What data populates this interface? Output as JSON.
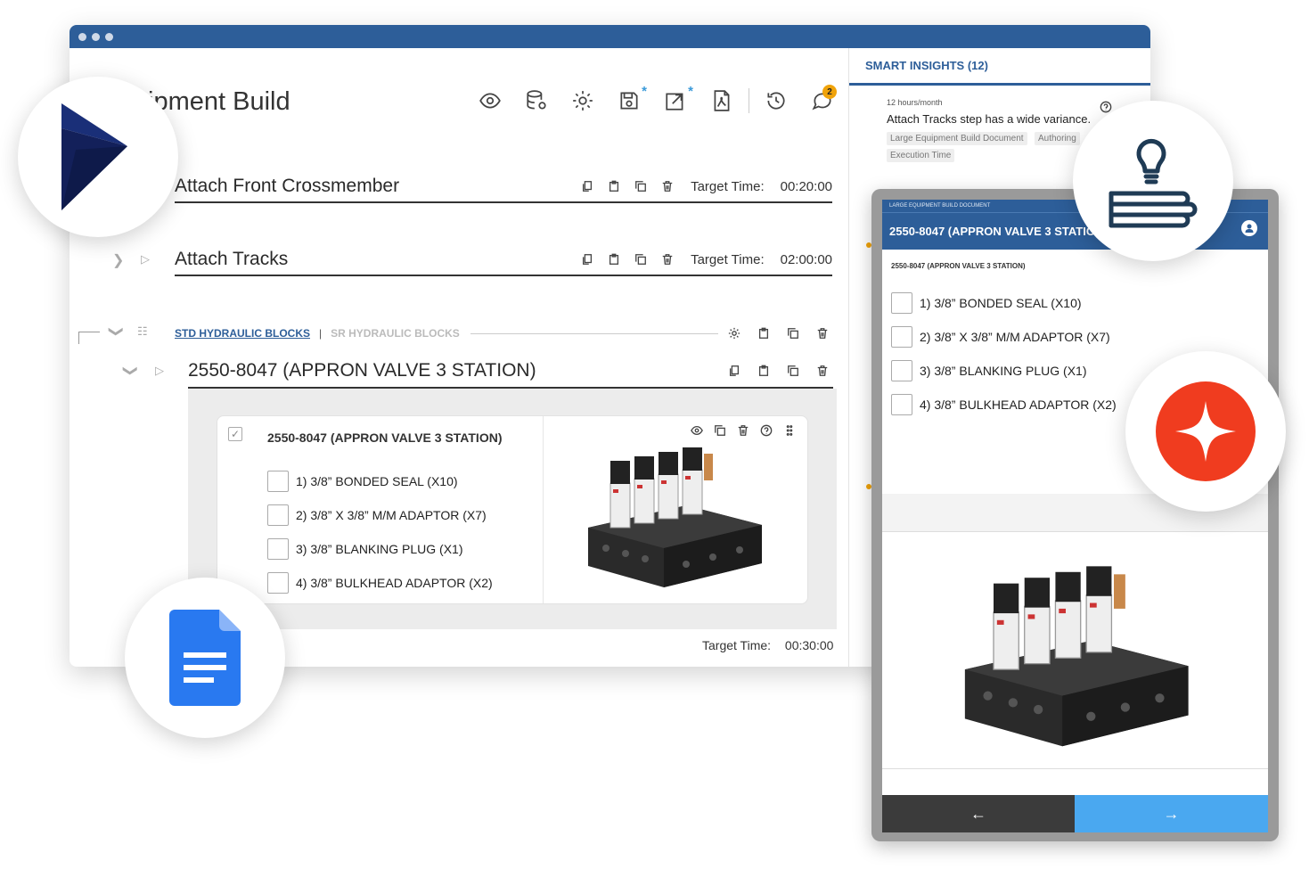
{
  "window": {
    "doc_title": "ipment Build"
  },
  "steps": [
    {
      "name": "Attach Front Crossmember",
      "target_label": "Target Time:",
      "target_value": "00:20:00"
    },
    {
      "name": "Attach Tracks",
      "target_label": "Target Time:",
      "target_value": "02:00:00"
    }
  ],
  "groups": {
    "active": "STD HYDRAULIC BLOCKS",
    "separator": "|",
    "other": "SR HYDRAULIC BLOCKS"
  },
  "substep": {
    "name": "2550-8047 (APPRON VALVE 3 STATION)"
  },
  "card": {
    "title": "2550-8047 (APPRON VALVE 3 STATION)",
    "items": [
      "1) 3/8” BONDED SEAL (X10)",
      "2) 3/8” X 3/8” M/M ADAPTOR (X7)",
      "3) 3/8” BLANKING PLUG (X1)",
      "4) 3/8” BULKHEAD ADAPTOR (X2)"
    ]
  },
  "bottom_target": {
    "label": "Target Time:",
    "value": "00:30:00"
  },
  "toolbar": {
    "comment_badge": "2"
  },
  "insights": {
    "heading": "SMART INSIGHTS (12)",
    "item_meta": "12 hours/month",
    "item_bold": "Attach Tracks",
    "item_text": " step has a wide variance.",
    "tags": [
      "Large Equipment Build Document",
      "Authoring",
      "Execution Time"
    ]
  },
  "tablet": {
    "status": "LARGE EQUIPMENT BUILD DOCUMENT",
    "header": "2550-8047 (APPRON VALVE 3 STATIO",
    "subtitle": "2550-8047 (APPRON VALVE 3 STATION)",
    "items": [
      "1) 3/8” BONDED SEAL (X10)",
      "2) 3/8” X 3/8” M/M ADAPTOR (X7)",
      "3) 3/8” BLANKING PLUG (X1)",
      "4) 3/8” BULKHEAD ADAPTOR (X2)"
    ],
    "back_glyph": "←",
    "next_glyph": "→"
  },
  "colors": {
    "brand_blue": "#2d5e99",
    "accent_blue": "#4aa8f0",
    "badge_orange": "#f0a30a",
    "dynamics_navy": "#13205a",
    "docs_blue": "#2979f0",
    "red_star": "#f03c1f"
  },
  "icons": [
    "eye-icon",
    "database-settings-icon",
    "gear-icon",
    "save-icon",
    "open-external-icon",
    "pdf-icon",
    "history-icon",
    "comment-icon",
    "copy-icon",
    "clipboard-icon",
    "duplicate-icon",
    "trash-icon",
    "help-icon",
    "drag-handle-icon",
    "user-icon",
    "dynamics-logo",
    "knowledge-books-icon",
    "star-logo",
    "google-docs-logo"
  ]
}
